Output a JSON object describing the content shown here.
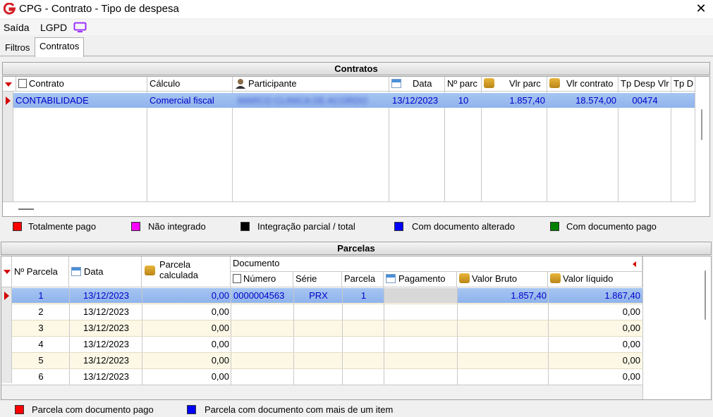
{
  "window": {
    "title": "CPG - Contrato - Tipo de despesa",
    "close_glyph": "✕"
  },
  "menu": {
    "saida": "Saída",
    "lgpd": "LGPD"
  },
  "tabs": [
    "Filtros",
    "Contratos"
  ],
  "contratos": {
    "header": "Contratos",
    "columns": [
      "Contrato",
      "Cálculo",
      "Participante",
      "Data",
      "Nº parc",
      "Vlr parc",
      "Vlr contrato",
      "Tp Desp Vlr",
      "Tp D"
    ],
    "rows": [
      {
        "contrato": "CONTABILIDADE",
        "calculo": "Comercial fiscal",
        "participante": "MARCO CLINICA DE ACORDO",
        "data": "13/12/2023",
        "nparc": "10",
        "vlr_parc": "1.857,40",
        "vlr_contrato": "18.574,00",
        "tp_desp": "00474",
        "tp_d": ""
      }
    ],
    "legend": [
      {
        "label": "Totalmente pago",
        "color": "#ff0000"
      },
      {
        "label": "Não integrado",
        "color": "#ff00ff"
      },
      {
        "label": "Integração parcial / total",
        "color": "#000000"
      },
      {
        "label": "Com documento alterado",
        "color": "#0000ff"
      },
      {
        "label": "Com documento pago",
        "color": "#008000"
      }
    ]
  },
  "parcelas": {
    "header": "Parcelas",
    "columns": {
      "nparcela": "Nº Parcela",
      "data": "Data",
      "parcela_calc": "Parcela calculada",
      "documento": "Documento",
      "numero": "Número",
      "serie": "Série",
      "parcela": "Parcela",
      "pagamento": "Pagamento",
      "valor_bruto": "Valor Bruto",
      "valor_liquido": "Valor líquido"
    },
    "rows": [
      {
        "n": "1",
        "data": "13/12/2023",
        "calc": "0,00",
        "numero": "0000004563",
        "serie": "PRX",
        "parcela": "1",
        "pagamento": "",
        "bruto": "1.857,40",
        "liquido": "1.867,40"
      },
      {
        "n": "2",
        "data": "13/12/2023",
        "calc": "0,00",
        "numero": "",
        "serie": "",
        "parcela": "",
        "pagamento": "",
        "bruto": "",
        "liquido": "0,00"
      },
      {
        "n": "3",
        "data": "13/12/2023",
        "calc": "0,00",
        "numero": "",
        "serie": "",
        "parcela": "",
        "pagamento": "",
        "bruto": "",
        "liquido": "0,00"
      },
      {
        "n": "4",
        "data": "13/12/2023",
        "calc": "0,00",
        "numero": "",
        "serie": "",
        "parcela": "",
        "pagamento": "",
        "bruto": "",
        "liquido": "0,00"
      },
      {
        "n": "5",
        "data": "13/12/2023",
        "calc": "0,00",
        "numero": "",
        "serie": "",
        "parcela": "",
        "pagamento": "",
        "bruto": "",
        "liquido": "0,00"
      },
      {
        "n": "6",
        "data": "13/12/2023",
        "calc": "0,00",
        "numero": "",
        "serie": "",
        "parcela": "",
        "pagamento": "",
        "bruto": "",
        "liquido": "0,00"
      }
    ],
    "legend": [
      {
        "label": "Parcela com documento pago",
        "color": "#ff0000"
      },
      {
        "label": "Parcela com documento com mais de um item",
        "color": "#0000ff"
      }
    ]
  },
  "colors": {
    "selection": "#a6c5f2",
    "selected_text": "#0000c8",
    "alt_row": "#fdf8e6"
  }
}
